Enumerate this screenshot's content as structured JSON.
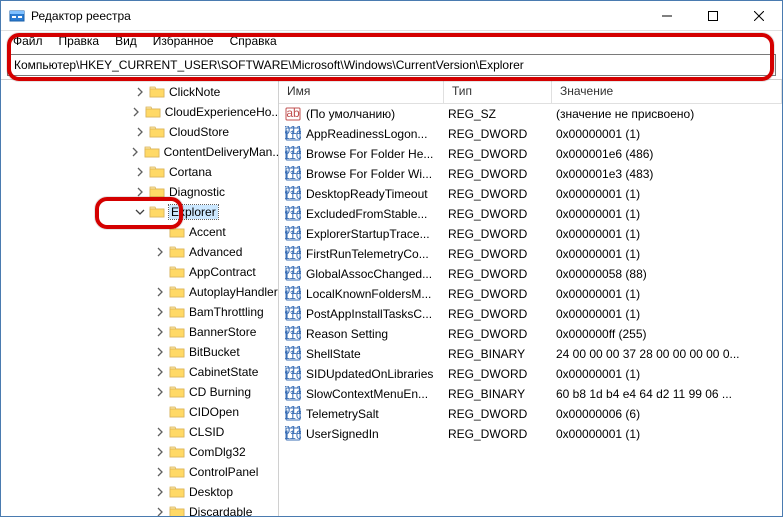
{
  "window": {
    "title": "Редактор реестра"
  },
  "menu": [
    "Файл",
    "Правка",
    "Вид",
    "Избранное",
    "Справка"
  ],
  "addressbar": "Компьютер\\HKEY_CURRENT_USER\\SOFTWARE\\Microsoft\\Windows\\CurrentVersion\\Explorer",
  "columns": {
    "name": "Имя",
    "type": "Тип",
    "value": "Значение"
  },
  "tree": [
    {
      "indent": 132,
      "exp": "right",
      "label": "ClickNote"
    },
    {
      "indent": 132,
      "exp": "right",
      "label": "CloudExperienceHo..."
    },
    {
      "indent": 132,
      "exp": "right",
      "label": "CloudStore"
    },
    {
      "indent": 132,
      "exp": "right",
      "label": "ContentDeliveryMan..."
    },
    {
      "indent": 132,
      "exp": "right",
      "label": "Cortana"
    },
    {
      "indent": 132,
      "exp": "right",
      "label": "Diagnostic"
    },
    {
      "indent": 132,
      "exp": "down",
      "label": "Explorer",
      "selected": true
    },
    {
      "indent": 152,
      "exp": "",
      "label": "Accent"
    },
    {
      "indent": 152,
      "exp": "right",
      "label": "Advanced"
    },
    {
      "indent": 152,
      "exp": "",
      "label": "AppContract"
    },
    {
      "indent": 152,
      "exp": "right",
      "label": "AutoplayHandler"
    },
    {
      "indent": 152,
      "exp": "right",
      "label": "BamThrottling"
    },
    {
      "indent": 152,
      "exp": "right",
      "label": "BannerStore"
    },
    {
      "indent": 152,
      "exp": "right",
      "label": "BitBucket"
    },
    {
      "indent": 152,
      "exp": "right",
      "label": "CabinetState"
    },
    {
      "indent": 152,
      "exp": "right",
      "label": "CD Burning"
    },
    {
      "indent": 152,
      "exp": "",
      "label": "CIDOpen"
    },
    {
      "indent": 152,
      "exp": "right",
      "label": "CLSID"
    },
    {
      "indent": 152,
      "exp": "right",
      "label": "ComDlg32"
    },
    {
      "indent": 152,
      "exp": "right",
      "label": "ControlPanel"
    },
    {
      "indent": 152,
      "exp": "right",
      "label": "Desktop"
    },
    {
      "indent": 152,
      "exp": "right",
      "label": "Discardable"
    }
  ],
  "values": [
    {
      "icon": "sz",
      "name": "(По умолчанию)",
      "type": "REG_SZ",
      "value": "(значение не присвоено)"
    },
    {
      "icon": "dw",
      "name": "AppReadinessLogon...",
      "type": "REG_DWORD",
      "value": "0x00000001 (1)"
    },
    {
      "icon": "dw",
      "name": "Browse For Folder He...",
      "type": "REG_DWORD",
      "value": "0x000001e6 (486)"
    },
    {
      "icon": "dw",
      "name": "Browse For Folder Wi...",
      "type": "REG_DWORD",
      "value": "0x000001e3 (483)"
    },
    {
      "icon": "dw",
      "name": "DesktopReadyTimeout",
      "type": "REG_DWORD",
      "value": "0x00000001 (1)"
    },
    {
      "icon": "dw",
      "name": "ExcludedFromStable...",
      "type": "REG_DWORD",
      "value": "0x00000001 (1)"
    },
    {
      "icon": "dw",
      "name": "ExplorerStartupTrace...",
      "type": "REG_DWORD",
      "value": "0x00000001 (1)"
    },
    {
      "icon": "dw",
      "name": "FirstRunTelemetryCo...",
      "type": "REG_DWORD",
      "value": "0x00000001 (1)"
    },
    {
      "icon": "dw",
      "name": "GlobalAssocChanged...",
      "type": "REG_DWORD",
      "value": "0x00000058 (88)"
    },
    {
      "icon": "dw",
      "name": "LocalKnownFoldersM...",
      "type": "REG_DWORD",
      "value": "0x00000001 (1)"
    },
    {
      "icon": "dw",
      "name": "PostAppInstallTasksC...",
      "type": "REG_DWORD",
      "value": "0x00000001 (1)"
    },
    {
      "icon": "dw",
      "name": "Reason Setting",
      "type": "REG_DWORD",
      "value": "0x000000ff (255)"
    },
    {
      "icon": "dw",
      "name": "ShellState",
      "type": "REG_BINARY",
      "value": "24 00 00 00 37 28 00 00 00 00 0..."
    },
    {
      "icon": "dw",
      "name": "SIDUpdatedOnLibraries",
      "type": "REG_DWORD",
      "value": "0x00000001 (1)"
    },
    {
      "icon": "dw",
      "name": "SlowContextMenuEn...",
      "type": "REG_BINARY",
      "value": "60 b8 1d b4 e4 64 d2 11 99 06 ..."
    },
    {
      "icon": "dw",
      "name": "TelemetrySalt",
      "type": "REG_DWORD",
      "value": "0x00000006 (6)"
    },
    {
      "icon": "dw",
      "name": "UserSignedIn",
      "type": "REG_DWORD",
      "value": "0x00000001 (1)"
    }
  ]
}
